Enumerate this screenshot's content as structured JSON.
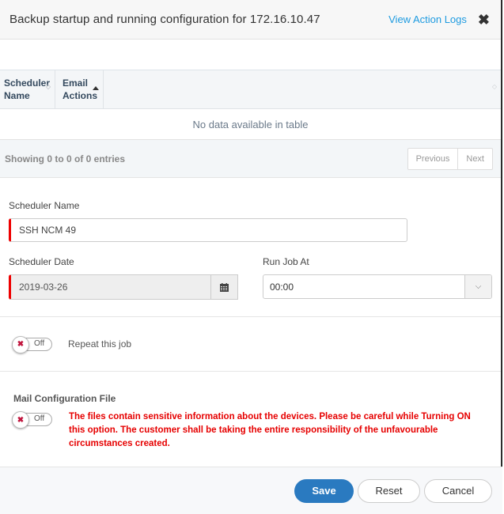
{
  "header": {
    "title": "Backup startup and running configuration for 172.16.10.47",
    "view_logs_label": "View Action Logs",
    "close_icon": "close-icon"
  },
  "table": {
    "columns": [
      {
        "label_line1": "Scheduler",
        "label_line2": "Name",
        "sort": "none"
      },
      {
        "label_line1": "Email",
        "label_line2": "Actions",
        "sort": "ascending"
      }
    ],
    "empty_text": "No data available in table",
    "info": "Showing 0 to 0 of 0 entries",
    "pager": {
      "previous": "Previous",
      "next": "Next"
    }
  },
  "form": {
    "scheduler_name_label": "Scheduler Name",
    "scheduler_name_value": "SSH NCM 49",
    "scheduler_date_label": "Scheduler Date",
    "scheduler_date_value": "2019-03-26",
    "run_job_label": "Run Job At",
    "run_job_value": "00:00",
    "calendar_icon": "calendar-icon"
  },
  "repeat": {
    "toggle_state": "Off",
    "label": "Repeat this job"
  },
  "mail": {
    "title": "Mail Configuration File",
    "toggle_state": "Off",
    "warning": "The files contain sensitive information about the devices. Please be careful while Turning ON this option. The customer shall be taking the entire responsibility of the unfavourable circumstances created."
  },
  "footer": {
    "save": "Save",
    "reset": "Reset",
    "cancel": "Cancel"
  },
  "colors": {
    "link": "#1e9be0",
    "primary": "#2a7ac0",
    "warning": "#e60000",
    "required_marker": "#e00000"
  }
}
